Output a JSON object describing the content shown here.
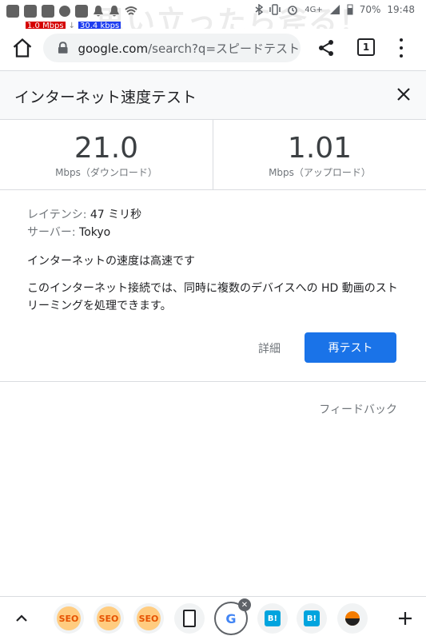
{
  "status_bar": {
    "battery": "70%",
    "time": "19:48",
    "network": "4G+",
    "watermark": "思い立ったら斧る！",
    "download_rate": "1.0 Mbps",
    "upload_rate": "30.4 kbps"
  },
  "browser": {
    "url_host": "google.com",
    "url_path": "/search?q=スピードテスト&",
    "tab_count": "1"
  },
  "card": {
    "title": "インターネット速度テスト",
    "download": {
      "value": "21.0",
      "unit": "Mbps（ダウンロード）"
    },
    "upload": {
      "value": "1.01",
      "unit": "Mbps（アップロード）"
    },
    "latency_label": "レイテンシ: ",
    "latency_value": "47 ミリ秒",
    "server_label": "サーバー: ",
    "server_value": "Tokyo",
    "status": "インターネットの速度は高速です",
    "description": "このインターネット接続では、同時に複数のデバイスへの HD 動画のストリーミングを処理できます。",
    "details_link": "詳細",
    "retest_button": "再テスト",
    "feedback": "フィードバック"
  },
  "bottom_tabs": {
    "seo_label": "SEO",
    "hatena_label": "B!",
    "google_label": "G",
    "close_glyph": "✕"
  }
}
